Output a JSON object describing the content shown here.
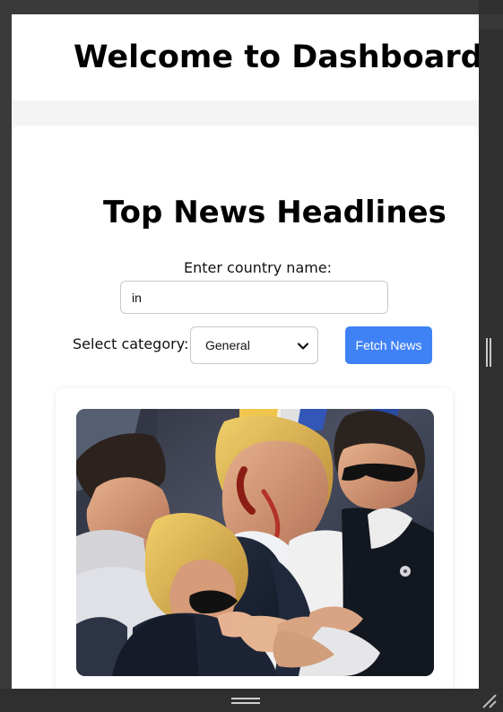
{
  "dashboard": {
    "title": "Welcome to Dashboard!"
  },
  "news": {
    "section_title": "Top News Headlines",
    "country_label": "Enter country name:",
    "country_value": "in",
    "category_label": "Select category:",
    "selected_category": "General",
    "fetch_label": "Fetch News"
  },
  "icons": {
    "dropdown": "chevron-down-icon",
    "panel_grip": "panel-grip-icon",
    "bottom_grip": "drag-handle-icon",
    "resize": "resize-icon"
  },
  "colors": {
    "accent": "#3f82f5",
    "page_background": "#f4f4f4",
    "card_background": "#ffffff",
    "frame": "#2f2f2f"
  }
}
